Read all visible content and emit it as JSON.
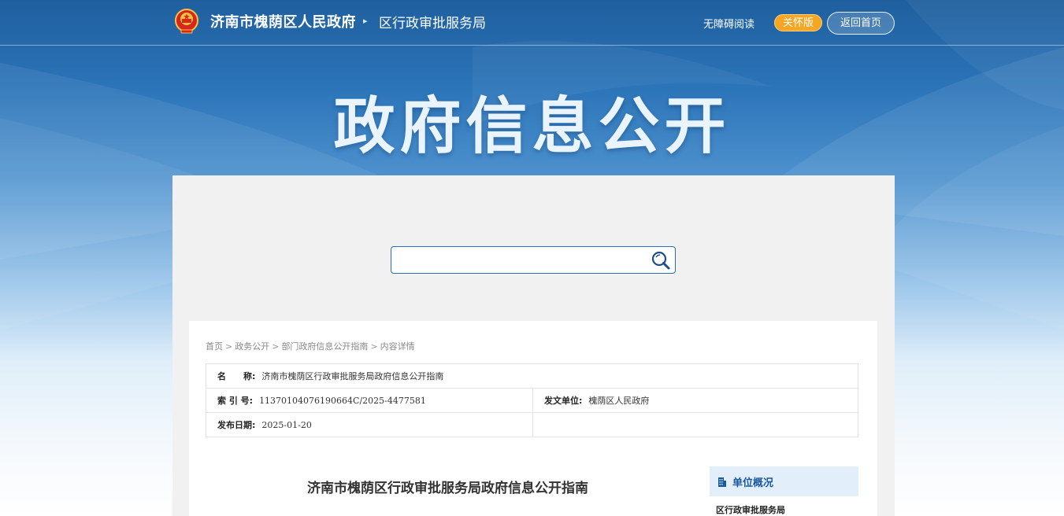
{
  "header": {
    "site_name": "济南市槐荫区人民政府",
    "separator_icon": "▸",
    "department": "区行政审批服务局",
    "accessibility_link": "无障碍阅读",
    "care_mode_button": "关怀版",
    "home_button": "返回首页"
  },
  "hero": {
    "title": "政府信息公开"
  },
  "search": {
    "placeholder": "",
    "value": ""
  },
  "breadcrumb": [
    "首页",
    "政务公开",
    "部门政府信息公开指南",
    "内容详情"
  ],
  "meta": {
    "name_label": "名　　称:",
    "name_value": "济南市槐荫区行政审批服务局政府信息公开指南",
    "index_label": "索 引 号:",
    "index_value": "11370104076190664C/2025-4477581",
    "issuer_label": "发文单位:",
    "issuer_value": "槐荫区人民政府",
    "date_label": "发布日期:",
    "date_value": "2025-01-20"
  },
  "document": {
    "title": "济南市槐荫区行政审批服务局政府信息公开指南"
  },
  "sidebar": {
    "heading": "单位概况",
    "items": [
      "区行政审批服务局"
    ]
  },
  "colors": {
    "brand_blue": "#1c5aa0",
    "care_orange": "#f5a623",
    "panel_gray": "#f1f1f1"
  }
}
